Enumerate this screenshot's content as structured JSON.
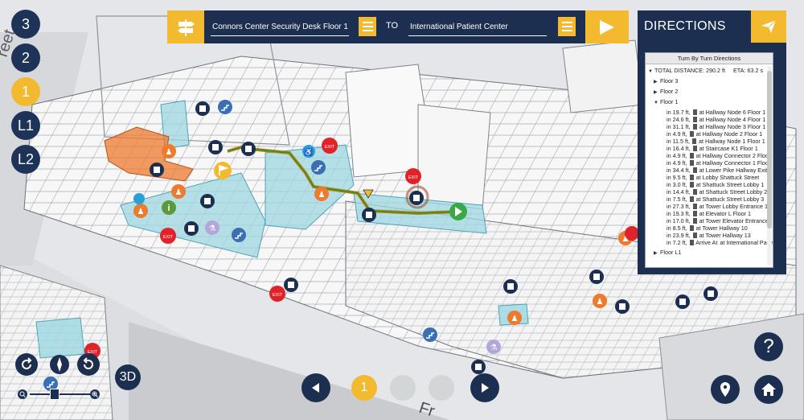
{
  "floors": {
    "items": [
      {
        "label": "3",
        "active": false
      },
      {
        "label": "2",
        "active": false
      },
      {
        "label": "1",
        "active": true
      },
      {
        "label": "L1",
        "active": false
      },
      {
        "label": "L2",
        "active": false
      }
    ]
  },
  "route": {
    "from_value": "Connors Center Security Desk Floor 1",
    "to_label": "TO",
    "to_value": "International Patient Center"
  },
  "directions": {
    "title": "DIRECTIONS",
    "list_header": "Turn By Turn Directions",
    "total_label": "TOTAL DISTANCE: 290.2 ft",
    "eta_label": "ETA: 63.2 s",
    "collapsed_floors": [
      "Floor 3",
      "Floor 2"
    ],
    "open_floor": "Floor 1",
    "steps": [
      "in 19.7 ft,",
      "at Hallway Node 6 Floor 1",
      "in 24.6 ft,",
      "at Hallway Node 4 Floor 1",
      "in 31.1 ft,",
      "at Hallway Node 3 Floor 1",
      "in 4.9 ft,",
      "at Hallway Node 2 Floor 1",
      "in 11.5 ft,",
      "at Hallway Node 1 Floor 1",
      "in 16.4 ft,",
      "at Staircase K1 Floor 1",
      "in 4.9 ft,",
      "at Hallway Connector 2 Floor",
      "in 4.9 ft,",
      "at Hallway Connector 1 Floor",
      "in 34.4 ft,",
      "at Lower Pike Hallway Exit...",
      "in 9.5 ft,",
      "at Lobby Shattuck Street",
      "in 3.0 ft,",
      "at Shattuck Street Lobby 1",
      "in 14.4 ft,",
      "at Shattuck Street Lobby 2",
      "in 7.5 ft,",
      "at Shattuck Street Lobby 3",
      "in 27.3 ft,",
      "at Tower Lobby Entrance 1",
      "in 19.3 ft,",
      "at Elevator L Floor 1",
      "in 17.0 ft,",
      "at Tower Elevator Entrance",
      "in 8.5 ft,",
      "at Tower Hallway 10",
      "in 23.9 ft,",
      "at Tower Hallway 13",
      "in 7.2 ft,",
      "Arrive At",
      "at International Patie..."
    ],
    "trailing_floors": [
      "Floor L1"
    ]
  },
  "map": {
    "exit_label": "EXIT",
    "street_label_top": "reet",
    "street_label_bottom": "Fr",
    "colors": {
      "navy": "#1d2f50",
      "gold": "#f3b92f",
      "orange": "#ee7a2e",
      "exit_red": "#e0222a",
      "route_green": "#3aa845",
      "glass": "#9ed7e2",
      "poi_blue": "#3a6fb3"
    }
  },
  "controls": {
    "view_3d_label": "3D",
    "current_page": "1",
    "help_icon": "?"
  }
}
